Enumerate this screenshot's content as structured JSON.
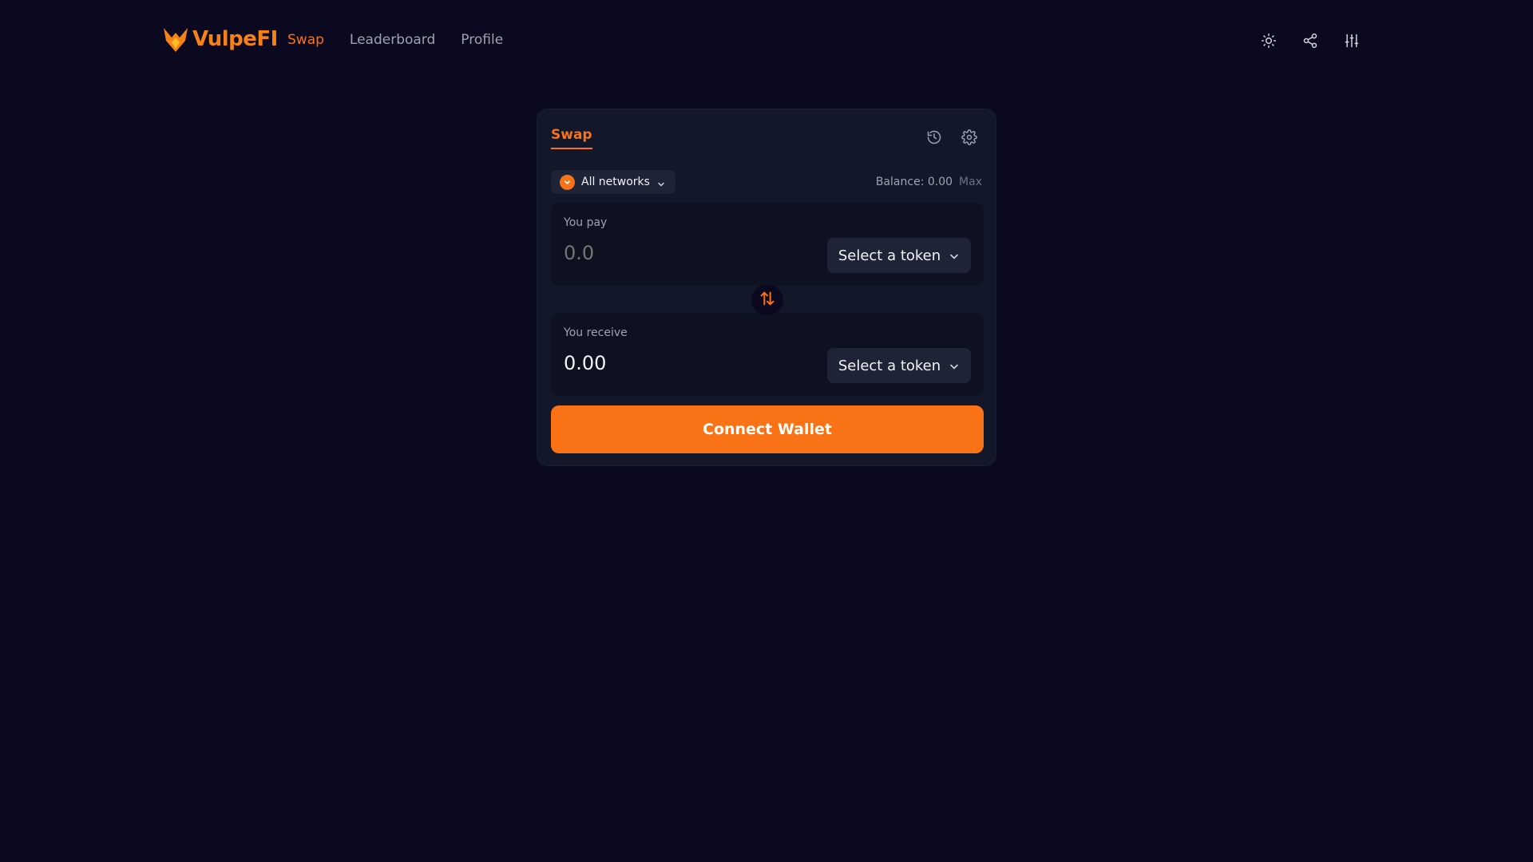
{
  "brand": {
    "name": "VulpeFI",
    "logo_icon": "fox-logo-icon",
    "color": "#f58216"
  },
  "nav": {
    "items": [
      {
        "label": "Swap",
        "active": true
      },
      {
        "label": "Leaderboard",
        "active": false
      },
      {
        "label": "Profile",
        "active": false
      }
    ]
  },
  "header_icons": [
    "sun-icon",
    "share-icon",
    "sliders-icon"
  ],
  "swap_card": {
    "tab": "Swap",
    "actions": [
      "history-icon",
      "gear-icon"
    ],
    "network": {
      "label": "All networks",
      "icon": "chevron-down-icon"
    },
    "balance": {
      "label": "Balance: 0.00",
      "max_label": "Max"
    },
    "pay": {
      "label": "You pay",
      "placeholder": "0.0",
      "token_label": "Select a token"
    },
    "receive": {
      "label": "You receive",
      "value": "0.00",
      "token_label": "Select a token"
    },
    "connect_label": "Connect Wallet"
  },
  "colors": {
    "accent": "#f97316",
    "background": "#0b0920",
    "card": "#13172a",
    "panel": "#0e1120"
  }
}
